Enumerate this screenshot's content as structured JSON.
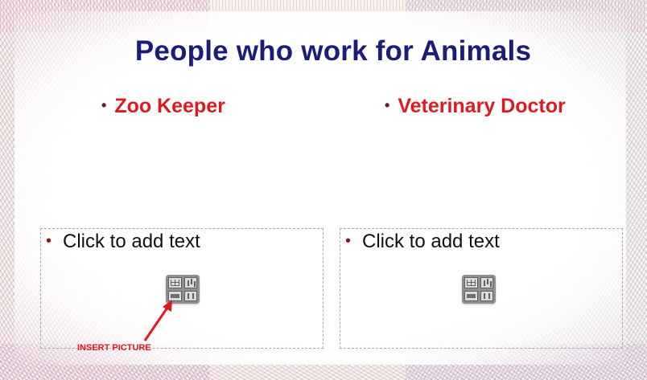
{
  "slide": {
    "title": "People who work for Animals",
    "columns": [
      {
        "heading": "Zoo Keeper",
        "placeholder_text": "Click to add text"
      },
      {
        "heading": "Veterinary Doctor",
        "placeholder_text": "Click to add text"
      }
    ],
    "bullet_glyph": "•"
  },
  "annotation": {
    "label": "INSERT PICTURE",
    "color": "#e0191e"
  },
  "icons": {
    "content_placeholder": "insert-content-icon",
    "table": "table-icon",
    "chart": "chart-icon",
    "picture": "picture-icon",
    "media": "media-icon"
  },
  "colors": {
    "title": "#1c1c7a",
    "headings": "#e0191e",
    "body_text": "#111111"
  }
}
